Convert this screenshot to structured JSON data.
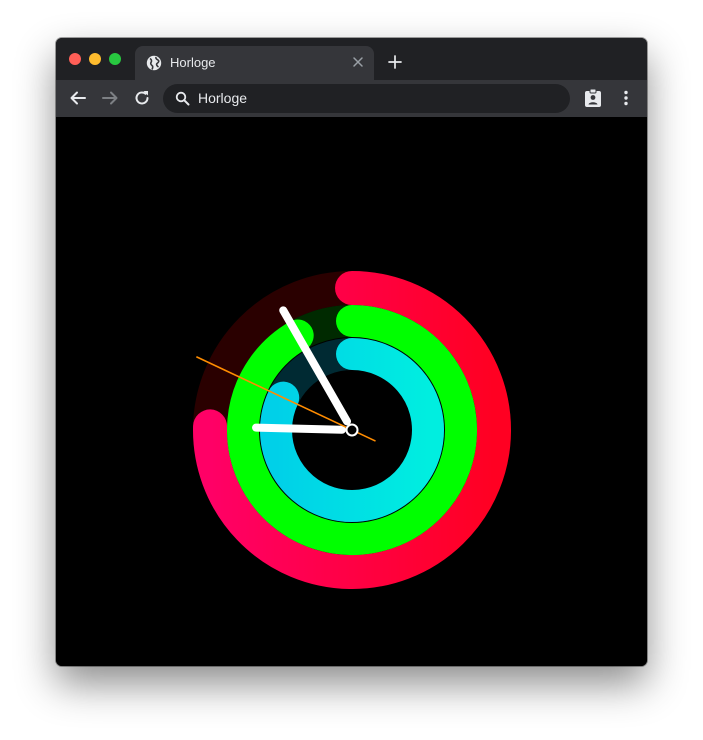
{
  "browser": {
    "tab": {
      "title": "Horloge",
      "icon": "globe-icon"
    },
    "toolbar": {
      "address": "Horloge",
      "back_icon": "back-arrow-icon",
      "forward_icon": "forward-arrow-icon",
      "reload_icon": "reload-icon",
      "search_icon": "search-icon",
      "profile_icon": "profile-badge-icon",
      "menu_icon": "kebab-menu-icon"
    }
  },
  "clock": {
    "hours_fraction": 0.754,
    "minutes_fraction": 0.917,
    "seconds_fraction": 0.82,
    "rings": {
      "outer": {
        "color_start": "#ff0066",
        "color_end": "#ff0022",
        "track": "#2a0000"
      },
      "middle": {
        "color": "#00ff00",
        "track": "#002a00"
      },
      "inner": {
        "color_start": "#00d0e8",
        "color_end": "#00eee0",
        "track": "#002a33"
      }
    },
    "hand_color": "#ffffff",
    "second_hand_color": "#ff8c00"
  }
}
